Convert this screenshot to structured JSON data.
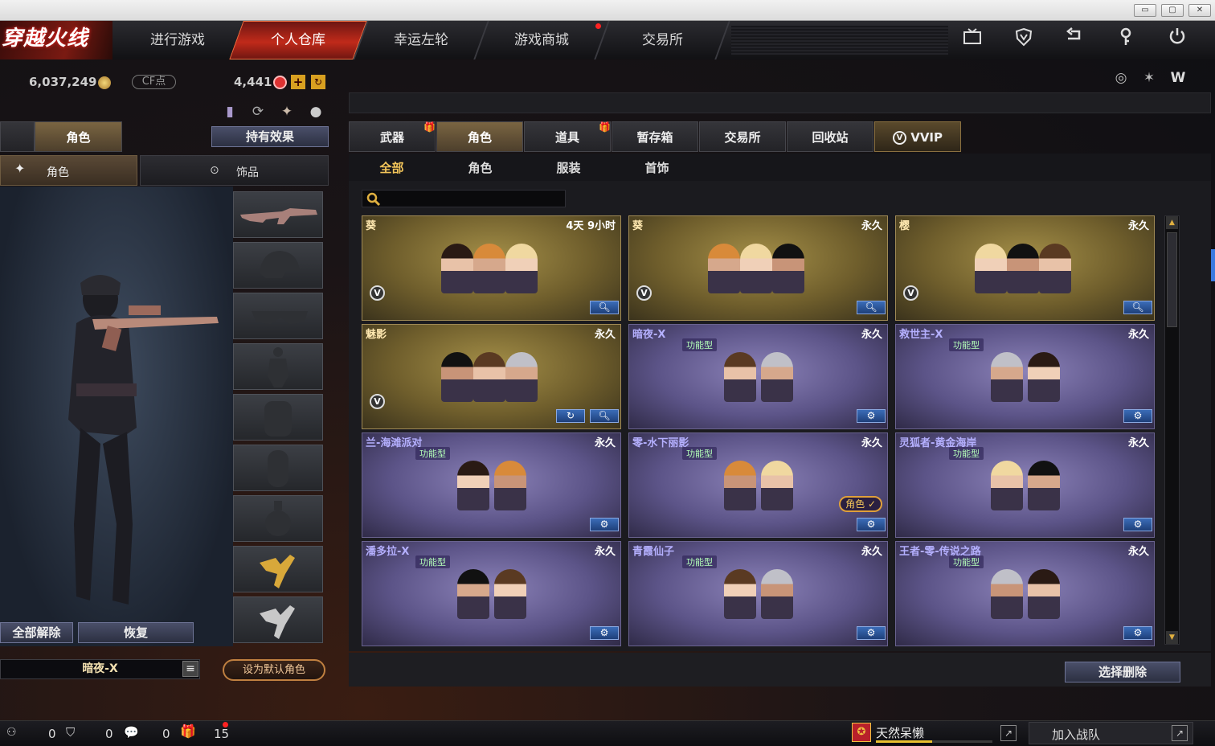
{
  "window_buttons": [
    "▭",
    "▢",
    "✕"
  ],
  "nav": {
    "logo": "穿越火线",
    "tabs": [
      {
        "label": "进行游戏"
      },
      {
        "label": "个人仓库",
        "active": true
      },
      {
        "label": "幸运左轮"
      },
      {
        "label": "游戏商城",
        "badge": true
      },
      {
        "label": "交易所"
      }
    ],
    "icons": [
      "tv-icon",
      "shield-icon",
      "return-icon",
      "key-icon",
      "power-icon"
    ]
  },
  "currency": {
    "gp": "6,037,249",
    "cf_label": "CF点",
    "cf_value": "4,441"
  },
  "left": {
    "top_tab_partial": "b",
    "tab_role": "角色",
    "tab_effects": "持有效果",
    "sub_role": "角色",
    "sub_accessory": "饰品",
    "btn_unequip": "全部解除",
    "btn_restore": "恢复",
    "current_name": "暗夜-X",
    "btn_default": "设为默认角色"
  },
  "inventory": {
    "tabs": [
      {
        "label": "武器",
        "gift": true
      },
      {
        "label": "角色",
        "active": true
      },
      {
        "label": "道具",
        "gift": true
      },
      {
        "label": "暂存箱"
      },
      {
        "label": "交易所"
      },
      {
        "label": "回收站"
      },
      {
        "label": "VVIP"
      }
    ],
    "subtabs": [
      {
        "label": "全部",
        "active": true
      },
      {
        "label": "角色"
      },
      {
        "label": "服装"
      },
      {
        "label": "首饰"
      }
    ],
    "search_placeholder": "",
    "items": [
      {
        "name": "葵",
        "duration": "4天 9小时",
        "style": "gold",
        "vip": true,
        "func": ""
      },
      {
        "name": "葵",
        "duration": "永久",
        "style": "gold",
        "vip": true,
        "func": ""
      },
      {
        "name": "樱",
        "duration": "永久",
        "style": "gold",
        "vip": true,
        "func": ""
      },
      {
        "name": "魅影",
        "duration": "永久",
        "style": "gold",
        "vip": true,
        "func": "",
        "refresh": true
      },
      {
        "name": "暗夜-X",
        "duration": "永久",
        "style": "purp",
        "func": "功能型"
      },
      {
        "name": "救世主-X",
        "duration": "永久",
        "style": "purp",
        "func": "功能型"
      },
      {
        "name": "兰-海滩派对",
        "duration": "永久",
        "style": "purp",
        "func": "功能型"
      },
      {
        "name": "零-水下丽影",
        "duration": "永久",
        "style": "purp",
        "func": "功能型",
        "badge": "角色 ✓"
      },
      {
        "name": "灵狐者-黄金海岸",
        "duration": "永久",
        "style": "purp",
        "func": "功能型"
      },
      {
        "name": "潘多拉-X",
        "duration": "永久",
        "style": "purp",
        "func": "功能型"
      },
      {
        "name": "青霞仙子",
        "duration": "永久",
        "style": "purp",
        "func": "功能型"
      },
      {
        "name": "王者-零-传说之路",
        "duration": "永久",
        "style": "purp",
        "func": "功能型"
      }
    ],
    "btn_delete": "选择删除"
  },
  "status": {
    "c1": "0",
    "c2": "0",
    "c3": "0",
    "gifts": "15",
    "user": "天然呆懒",
    "join": "加入战队"
  }
}
